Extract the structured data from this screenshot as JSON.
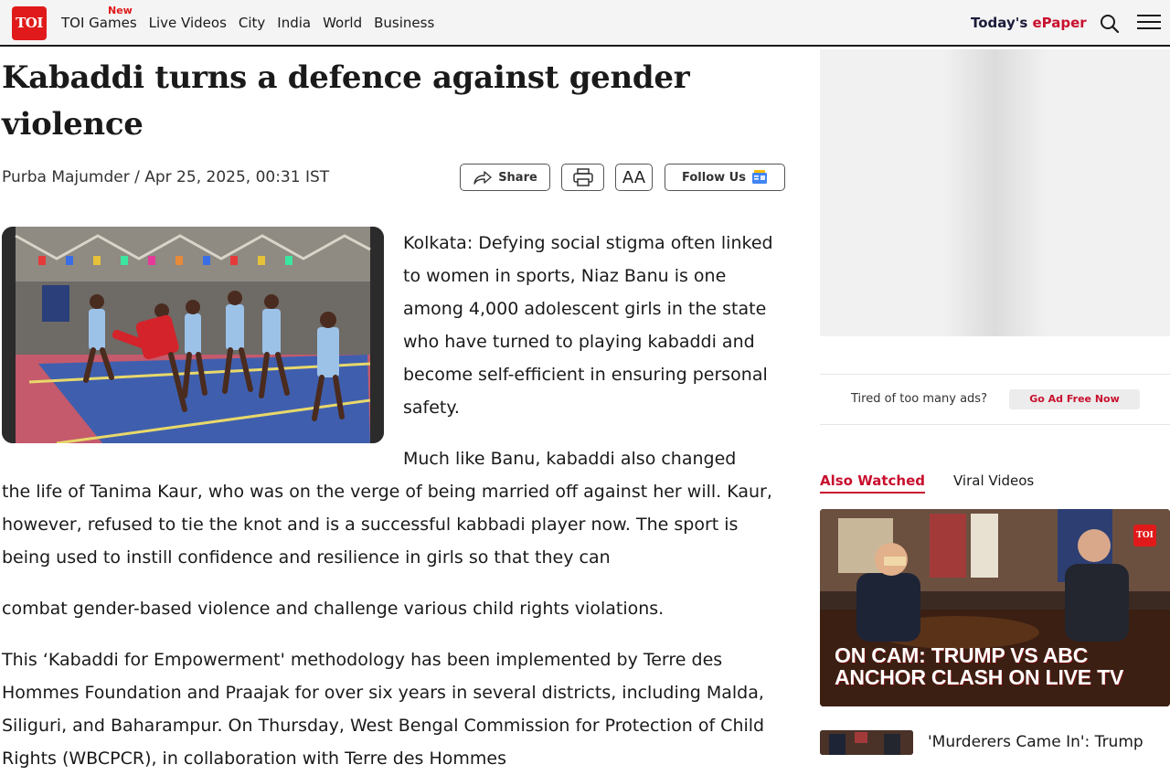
{
  "header": {
    "logo": "TOI",
    "nav": [
      "TOI Games",
      "Live Videos",
      "City",
      "India",
      "World",
      "Business"
    ],
    "new_badge": "New",
    "epaper_prefix": "Today's ",
    "epaper_suffix": "ePaper"
  },
  "article": {
    "title": "Kabaddi turns a defence against gender violence",
    "byline": "Purba Majumder / Apr 25, 2025, 00:31 IST",
    "share_label": "Share",
    "font_label": "AA",
    "follow_label": "Follow Us",
    "p1": "Kolkata: Defying social stigma often linked to women in sports, Niaz Banu is one among 4,000 adolescent girls in the state who have turned to playing kabaddi and become self-efficient in ensuring personal safety.",
    "p2_start": "Much like Banu, kabaddi also changed",
    "p2_rest": "the life of Tanima Kaur, who was on the verge of being married off against her will. Kaur, however, refused to tie the knot and is a successful kabbadi player now. The sport is being used to instill confidence and resilience in girls so that they can",
    "p3": "combat gender-based violence and challenge various child rights violations.",
    "p4": "This ‘Kabaddi for Empowerment' methodology has been implemented by Terre des Hommes Foundation and Praajak for over six years in several districts, including Malda, Siliguri, and Baharampur. On Thursday, West Bengal Commission for Protection of Child Rights (WBCPCR), in collaboration with Terre des Hommes"
  },
  "sidebar": {
    "tired_text": "Tired of too many ads?",
    "adfree_label": "Go Ad Free Now",
    "tabs": {
      "also": "Also Watched",
      "viral": "Viral Videos"
    },
    "video_caption_1": "ON CAM: TRUMP VS ABC",
    "video_caption_2": "ANCHOR CLASH ON LIVE TV",
    "video_logo": "TOI",
    "next_title": "'Murderers Came In': Trump"
  },
  "colors": {
    "brand_red": "#e01a1a",
    "accent_red": "#c8102e"
  }
}
